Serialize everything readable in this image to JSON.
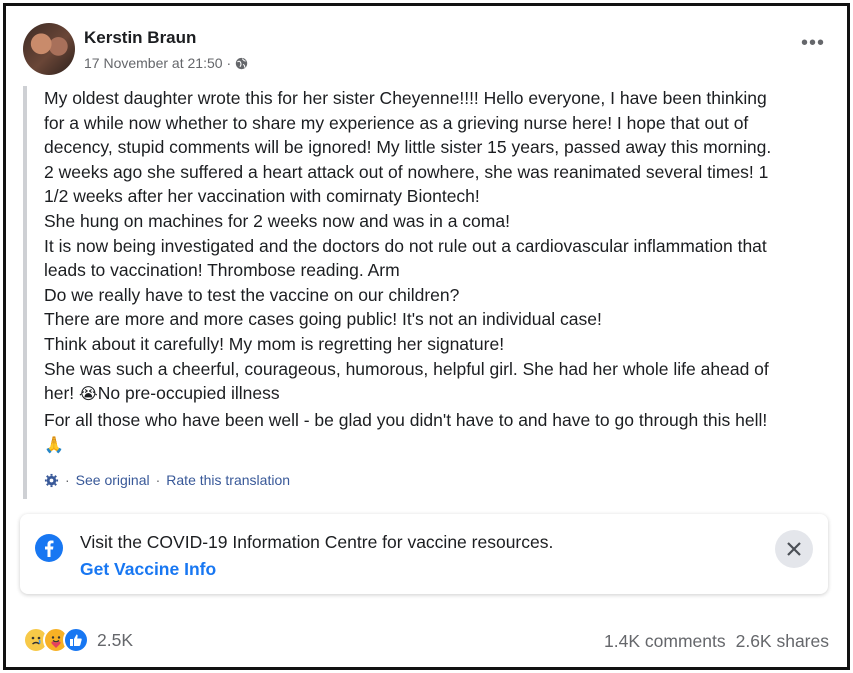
{
  "post": {
    "author": "Kerstin Braun",
    "timestamp": "17 November at 21:50",
    "separator": "·",
    "privacy_icon": "globe-icon",
    "more_icon": "•••",
    "lines": [
      "My oldest daughter wrote this for her sister Cheyenne!!!! Hello everyone, I have been thinking",
      "for a while now whether to share my experience as a grieving nurse here! I hope that out of",
      "decency, stupid comments will be ignored! My little sister 15 years, passed away this morning.",
      "2 weeks ago she suffered a heart attack out of nowhere, she was reanimated several times! 1",
      "1/2 weeks after her vaccination with comirnaty Biontech!",
      "She hung on machines for 2 weeks now and was in a coma!",
      "It is now being investigated and the doctors do not rule out a cardiovascular inflammation that",
      "leads to vaccination! Thrombose reading. Arm",
      "Do we really have to test the vaccine on our children?",
      "There are more and more cases going public! It's not an individual case!",
      "Think about it carefully! My mom is regretting her signature!",
      "She was such a cheerful, courageous, humorous, helpful girl. She had her whole life ahead of"
    ],
    "line13_start": "her! ",
    "line13_emoji": "😭",
    "line13_end": "No pre-occupied illness",
    "line14": "For all those who have been well - be glad you didn't have to and have to go through this hell!",
    "line15_emoji": "🙏"
  },
  "translation": {
    "sep1": "·",
    "see_original": "See original",
    "sep2": "·",
    "rate": "Rate this translation"
  },
  "info_card": {
    "text": "Visit the COVID-19 Information Centre for vaccine resources.",
    "link": "Get Vaccine Info"
  },
  "footer": {
    "reaction_icons": [
      "sad",
      "care",
      "like"
    ],
    "reaction_count": "2.5K",
    "comments": "1.4K comments",
    "shares": "2.6K shares"
  },
  "colors": {
    "link_blue": "#1877f2",
    "translation_blue": "#385898",
    "muted": "#65676b"
  }
}
